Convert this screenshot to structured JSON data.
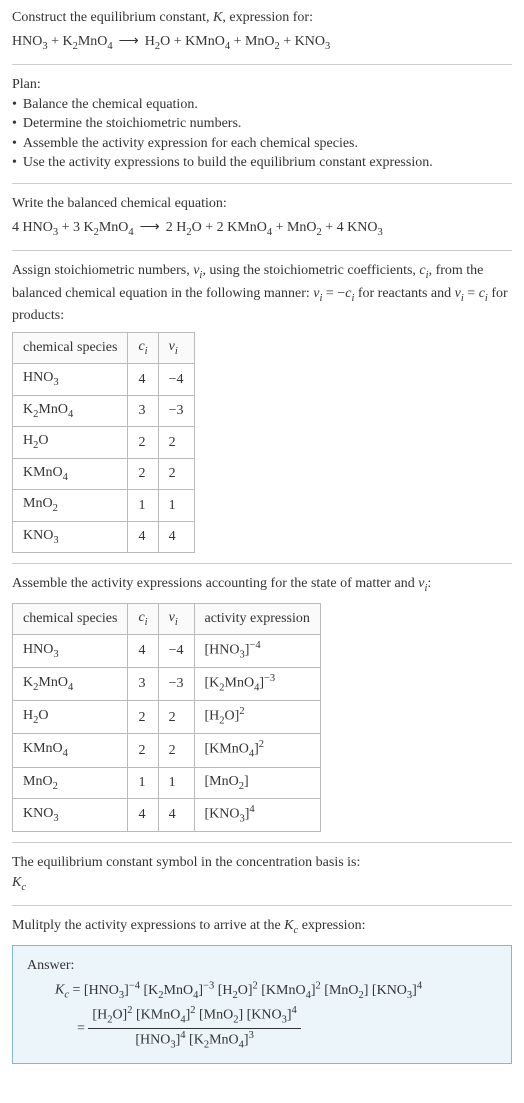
{
  "intro": {
    "line1_pre": "Construct the equilibrium constant, ",
    "line1_k": "K",
    "line1_post": ", expression for:"
  },
  "eq1": {
    "lhs": [
      {
        "f": "HNO",
        "s": "3"
      },
      {
        "plus": " + "
      },
      {
        "f": "K",
        "s": "2"
      },
      {
        "f": "MnO",
        "s": "4"
      }
    ],
    "rhs": [
      {
        "f": "H",
        "s": "2"
      },
      {
        "f": "O"
      },
      {
        "plus": " + "
      },
      {
        "f": "KMnO",
        "s": "4"
      },
      {
        "plus": " + "
      },
      {
        "f": "MnO",
        "s": "2"
      },
      {
        "plus": " + "
      },
      {
        "f": "KNO",
        "s": "3"
      }
    ]
  },
  "plan": {
    "title": "Plan:",
    "items": [
      "Balance the chemical equation.",
      "Determine the stoichiometric numbers.",
      "Assemble the activity expression for each chemical species.",
      "Use the activity expressions to build the equilibrium constant expression."
    ]
  },
  "balanced": {
    "title": "Write the balanced chemical equation:"
  },
  "eq2": {
    "lhs": [
      {
        "t": "4 "
      },
      {
        "f": "HNO",
        "s": "3"
      },
      {
        "plus": " + "
      },
      {
        "t": "3 "
      },
      {
        "f": "K",
        "s": "2"
      },
      {
        "f": "MnO",
        "s": "4"
      }
    ],
    "rhs": [
      {
        "t": "2 "
      },
      {
        "f": "H",
        "s": "2"
      },
      {
        "f": "O"
      },
      {
        "plus": " + "
      },
      {
        "t": "2 "
      },
      {
        "f": "KMnO",
        "s": "4"
      },
      {
        "plus": " + "
      },
      {
        "f": "MnO",
        "s": "2"
      },
      {
        "plus": " + "
      },
      {
        "t": "4 "
      },
      {
        "f": "KNO",
        "s": "3"
      }
    ]
  },
  "assign": {
    "p1": "Assign stoichiometric numbers, ",
    "nu": "ν",
    "i": "i",
    "p2": ", using the stoichiometric coefficients, ",
    "c": "c",
    "p3": ", from the balanced chemical equation in the following manner: ",
    "rel1a": "ν",
    "rel1b": "i",
    "rel1c": " = −",
    "rel1d": "c",
    "rel1e": "i",
    "p4": " for reactants and ",
    "rel2a": "ν",
    "rel2b": "i",
    "rel2c": " = ",
    "rel2d": "c",
    "rel2e": "i",
    "p5": " for products:"
  },
  "table1": {
    "h1": "chemical species",
    "h2": "c",
    "h2s": "i",
    "h3": "ν",
    "h3s": "i",
    "rows": [
      {
        "sp": [
          {
            "f": "HNO",
            "s": "3"
          }
        ],
        "c": "4",
        "v": "−4"
      },
      {
        "sp": [
          {
            "f": "K",
            "s": "2"
          },
          {
            "f": "MnO",
            "s": "4"
          }
        ],
        "c": "3",
        "v": "−3"
      },
      {
        "sp": [
          {
            "f": "H",
            "s": "2"
          },
          {
            "f": "O"
          }
        ],
        "c": "2",
        "v": "2"
      },
      {
        "sp": [
          {
            "f": "KMnO",
            "s": "4"
          }
        ],
        "c": "2",
        "v": "2"
      },
      {
        "sp": [
          {
            "f": "MnO",
            "s": "2"
          }
        ],
        "c": "1",
        "v": "1"
      },
      {
        "sp": [
          {
            "f": "KNO",
            "s": "3"
          }
        ],
        "c": "4",
        "v": "4"
      }
    ]
  },
  "assemble": {
    "p1": "Assemble the activity expressions accounting for the state of matter and ",
    "nu": "ν",
    "i": "i",
    "p2": ":"
  },
  "table2": {
    "h1": "chemical species",
    "h2": "c",
    "h2s": "i",
    "h3": "ν",
    "h3s": "i",
    "h4": "activity expression",
    "rows": [
      {
        "sp": [
          {
            "f": "HNO",
            "s": "3"
          }
        ],
        "c": "4",
        "v": "−4",
        "ae": [
          {
            "b": "[HNO",
            "s": "3",
            "e": "]",
            "p": "−4"
          }
        ]
      },
      {
        "sp": [
          {
            "f": "K",
            "s": "2"
          },
          {
            "f": "MnO",
            "s": "4"
          }
        ],
        "c": "3",
        "v": "−3",
        "ae": [
          {
            "b": "[K",
            "s": "2",
            "m": "MnO",
            "s2": "4",
            "e": "]",
            "p": "−3"
          }
        ]
      },
      {
        "sp": [
          {
            "f": "H",
            "s": "2"
          },
          {
            "f": "O"
          }
        ],
        "c": "2",
        "v": "2",
        "ae": [
          {
            "b": "[H",
            "s": "2",
            "m": "O]",
            "p": "2"
          }
        ]
      },
      {
        "sp": [
          {
            "f": "KMnO",
            "s": "4"
          }
        ],
        "c": "2",
        "v": "2",
        "ae": [
          {
            "b": "[KMnO",
            "s": "4",
            "e": "]",
            "p": "2"
          }
        ]
      },
      {
        "sp": [
          {
            "f": "MnO",
            "s": "2"
          }
        ],
        "c": "1",
        "v": "1",
        "ae": [
          {
            "b": "[MnO",
            "s": "2",
            "e": "]"
          }
        ]
      },
      {
        "sp": [
          {
            "f": "KNO",
            "s": "3"
          }
        ],
        "c": "4",
        "v": "4",
        "ae": [
          {
            "b": "[KNO",
            "s": "3",
            "e": "]",
            "p": "4"
          }
        ]
      }
    ]
  },
  "concbasis": {
    "p1": "The equilibrium constant symbol in the concentration basis is:",
    "k": "K",
    "c": "c"
  },
  "multiply": {
    "p1": "Mulitply the activity expressions to arrive at the ",
    "k": "K",
    "c": "c",
    "p2": " expression:"
  },
  "answer": {
    "label": "Answer:",
    "kc_k": "K",
    "kc_c": "c",
    "eq": " = "
  }
}
